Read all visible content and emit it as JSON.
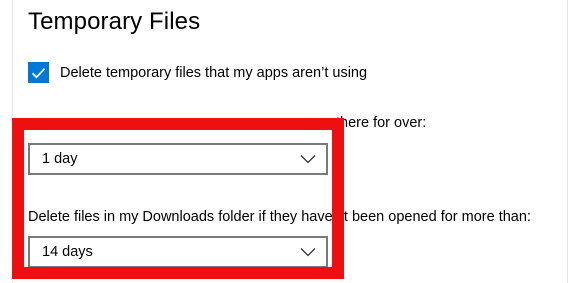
{
  "section": {
    "title": "Temporary Files"
  },
  "checkbox": {
    "label": "Delete temporary files that my apps aren’t using",
    "checked": true,
    "color": "#0078d7"
  },
  "recycle_bin": {
    "label_visible": "there for over:",
    "dropdown_value": "1 day"
  },
  "downloads": {
    "label": "Delete files in my Downloads folder if they haven’t been opened for more than:",
    "dropdown_value": "14 days"
  },
  "icons": {
    "checkmark": "checkmark-icon",
    "dropdown_chevron": "chevron-down-icon"
  },
  "colors": {
    "highlight": "#ee1010",
    "accent": "#0078d7",
    "dropdown_border": "#7a7a7a"
  }
}
